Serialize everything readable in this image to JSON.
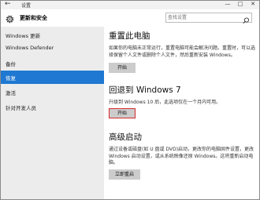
{
  "window": {
    "title": "设置",
    "back_glyph": "←",
    "controls": [
      "—",
      "□",
      "✕"
    ]
  },
  "header": {
    "section_title": "更新和安全",
    "search": {
      "placeholder": "查找设置"
    }
  },
  "sidebar": {
    "items": [
      {
        "label": "Windows 更新",
        "active": false
      },
      {
        "label": "Windows Defender",
        "active": false
      },
      {
        "label": "备份",
        "active": false
      },
      {
        "label": "恢复",
        "active": true
      },
      {
        "label": "激活",
        "active": false
      },
      {
        "label": "针对开发人员",
        "active": false
      }
    ]
  },
  "main": {
    "reset": {
      "heading": "重置此电脑",
      "text": "如果你的电脑未正常运行，重置电脑可能会解决问题。重置时，可以选择保留个人文件或删除个人文件，然后重新安装 Windows。",
      "button": "开始"
    },
    "rollback": {
      "heading": "回退到 Windows 7",
      "text": "升级到 Windows 10 后，此选项仅在一个月内可用。",
      "button": "开始"
    },
    "advanced": {
      "heading": "高级启动",
      "text": "通过设备或磁盘(如 U 盘或 DVD)启动，更改你的电脑固件设置，更改 Windows 启动设置，或从系统映像还原 Windows。这将重新启动电脑。",
      "button": "立即重启"
    }
  },
  "colors": {
    "accent": "#1f78d1",
    "highlight_border": "#d62a2a",
    "sidebar_bg": "#ececec",
    "button_bg": "#cccccc"
  }
}
